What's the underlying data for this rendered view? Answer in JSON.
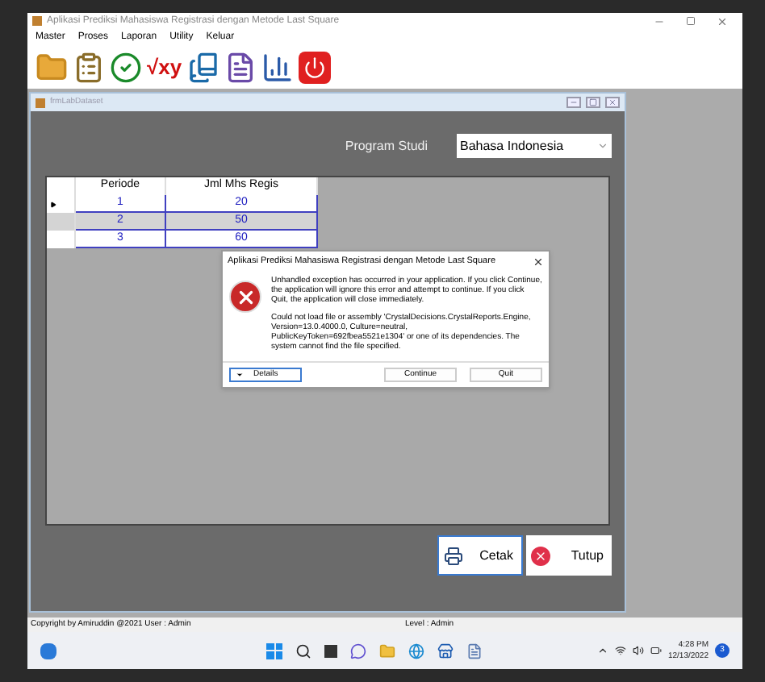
{
  "window": {
    "title": "Aplikasi Prediksi Mahasiswa Registrasi dengan Metode Last Square"
  },
  "menu": [
    "Master",
    "Proses",
    "Laporan",
    "Utility",
    "Keluar"
  ],
  "toolbar": [
    {
      "kind": "folder"
    },
    {
      "kind": "clipboard"
    },
    {
      "kind": "check"
    },
    {
      "kind": "glyph",
      "text": "√xy"
    },
    {
      "kind": "book"
    },
    {
      "kind": "document"
    },
    {
      "kind": "chart"
    },
    {
      "kind": "power"
    }
  ],
  "child_window": {
    "title": "frmLabDataset",
    "program_label": "Program Studi",
    "program_value": "Bahasa Indonesia",
    "table": {
      "columns": [
        "Periode",
        "Jml Mhs Regis"
      ],
      "rows": [
        {
          "cells": [
            "1",
            "20"
          ],
          "selected": false,
          "current": true
        },
        {
          "cells": [
            "2",
            "50"
          ],
          "selected": true,
          "current": false
        },
        {
          "cells": [
            "3",
            "60"
          ],
          "selected": false,
          "current": false
        }
      ]
    },
    "buttons": [
      {
        "kind": "print",
        "label": "Cetak"
      },
      {
        "kind": "close",
        "label": "Tutup"
      }
    ]
  },
  "dialog": {
    "title": "Aplikasi Prediksi Mahasiswa Registrasi dengan Metode Last Square",
    "message": "Unhandled exception has occurred in your application. If you click Continue, the application will ignore this error and attempt to continue. If you click Quit, the application will close immediately.",
    "detail": "Could not load file or assembly 'CrystalDecisions.CrystalReports.Engine, Version=13.0.4000.0, Culture=neutral, PublicKeyToken=692fbea5521e1304' or one of its dependencies. The system cannot find the file specified.",
    "details_button": "Details",
    "buttons": [
      "Continue",
      "Quit"
    ]
  },
  "status_bar": {
    "copyright": "Copyright by Amiruddin @2021  User : Admin",
    "level": "Level : Admin"
  },
  "taskbar": {
    "time": "4:28 PM",
    "date": "12/13/2022",
    "badge": "3"
  }
}
